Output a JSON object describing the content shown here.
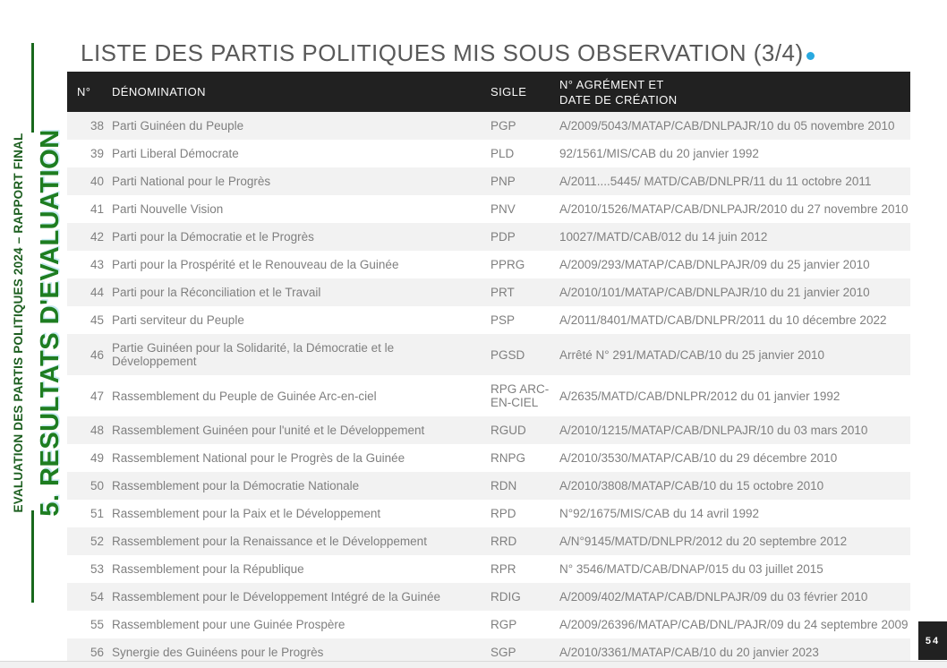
{
  "sidebar": {
    "report_label": "EVALUATION DES PARTIS POLITIQUES 2024 – RAPPORT FINAL",
    "section_label": "5. RESULTATS D'EVALUATION"
  },
  "header": {
    "title": "LISTE DES PARTIS POLITIQUES MIS SOUS OBSERVATION (3/4)"
  },
  "table": {
    "columns": [
      "N°",
      "DÉNOMINATION",
      "SIGLE",
      "N° AGRÉMENT ET\nDATE DE CRÉATION"
    ],
    "rows": [
      {
        "num": "38",
        "name": "Parti Guinéen du Peuple",
        "sigle": "PGP",
        "agrement": "A/2009/5043/MATAP/CAB/DNLPAJR/10 du 05 novembre 2010"
      },
      {
        "num": "39",
        "name": "Parti Liberal Démocrate",
        "sigle": "PLD",
        "agrement": "92/1561/MIS/CAB du 20 janvier 1992"
      },
      {
        "num": "40",
        "name": "Parti National pour le Progrès",
        "sigle": "PNP",
        "agrement": "A/2011....5445/ MATD/CAB/DNLPR/11 du 11 octobre 2011"
      },
      {
        "num": "41",
        "name": "Parti Nouvelle Vision",
        "sigle": "PNV",
        "agrement": "A/2010/1526/MATAP/CAB/DNLPAJR/2010 du 27 novembre 2010"
      },
      {
        "num": "42",
        "name": "Parti pour la Démocratie et le Progrès",
        "sigle": "PDP",
        "agrement": "10027/MATD/CAB/012 du 14 juin 2012"
      },
      {
        "num": "43",
        "name": "Parti pour la Prospérité et le Renouveau de la Guinée",
        "sigle": "PPRG",
        "agrement": "A/2009/293/MATAP/CAB/DNLPAJR/09 du 25 janvier 2010"
      },
      {
        "num": "44",
        "name": "Parti pour la Réconciliation et le Travail",
        "sigle": "PRT",
        "agrement": "A/2010/101/MATAP/CAB/DNLPAJR/10 du 21 janvier 2010"
      },
      {
        "num": "45",
        "name": "Parti serviteur du Peuple",
        "sigle": "PSP",
        "agrement": "A/2011/8401/MATD/CAB/DNLPR/2011 du 10 décembre 2022"
      },
      {
        "num": "46",
        "name": "Partie Guinéen pour la Solidarité, la Démocratie et le Développement",
        "sigle": "PGSD",
        "agrement": "Arrêté N° 291/MATAD/CAB/10 du 25 janvier 2010"
      },
      {
        "num": "47",
        "name": "Rassemblement du Peuple de Guinée Arc-en-ciel",
        "sigle": "RPG ARC-EN-CIEL",
        "agrement": "A/2635/MATD/CAB/DNLPR/2012 du 01 janvier 1992"
      },
      {
        "num": "48",
        "name": "Rassemblement Guinéen pour l'unité et le Développement",
        "sigle": "RGUD",
        "agrement": "A/2010/1215/MATAP/CAB/DNLPAJR/10 du 03 mars 2010"
      },
      {
        "num": "49",
        "name": "Rassemblement National pour le Progrès de la Guinée",
        "sigle": "RNPG",
        "agrement": "A/2010/3530/MATAP/CAB/10 du 29 décembre 2010"
      },
      {
        "num": "50",
        "name": "Rassemblement pour la Démocratie Nationale",
        "sigle": "RDN",
        "agrement": "A/2010/3808/MATAP/CAB/10 du 15 octobre 2010"
      },
      {
        "num": "51",
        "name": "Rassemblement pour la Paix et le Développement",
        "sigle": "RPD",
        "agrement": "N°92/1675/MIS/CAB du 14 avril 1992"
      },
      {
        "num": "52",
        "name": "Rassemblement pour la Renaissance et le Développement",
        "sigle": "RRD",
        "agrement": "A/N°9145/MATD/DNLPR/2012 du 20 septembre 2012"
      },
      {
        "num": "53",
        "name": "Rassemblement pour la République",
        "sigle": "RPR",
        "agrement": "N° 3546/MATD/CAB/DNAP/015 du 03 juillet 2015"
      },
      {
        "num": "54",
        "name": "Rassemblement pour le Développement Intégré de la Guinée",
        "sigle": "RDIG",
        "agrement": "A/2009/402/MATAP/CAB/DNLPAJR/09 du 03 février 2010"
      },
      {
        "num": "55",
        "name": "Rassemblement pour une Guinée Prospère",
        "sigle": "RGP",
        "agrement": "A/2009/26396/MATAP/CAB/DNL/PAJR/09 du 24 septembre 2009"
      },
      {
        "num": "56",
        "name": "Synergie des Guinéens pour le Progrès",
        "sigle": "SGP",
        "agrement": "A/2010/3361/MATAP/CAB/10 du 20 janvier 2023"
      }
    ]
  },
  "footer": {
    "page_number": "54"
  },
  "colors": {
    "accent_blue": "#29a9e0",
    "sidebar_green": "#1e7d20",
    "sidebar_dark_green": "#1c5e1f",
    "header_bg": "#212121",
    "stripe": "#f2f2f2"
  }
}
